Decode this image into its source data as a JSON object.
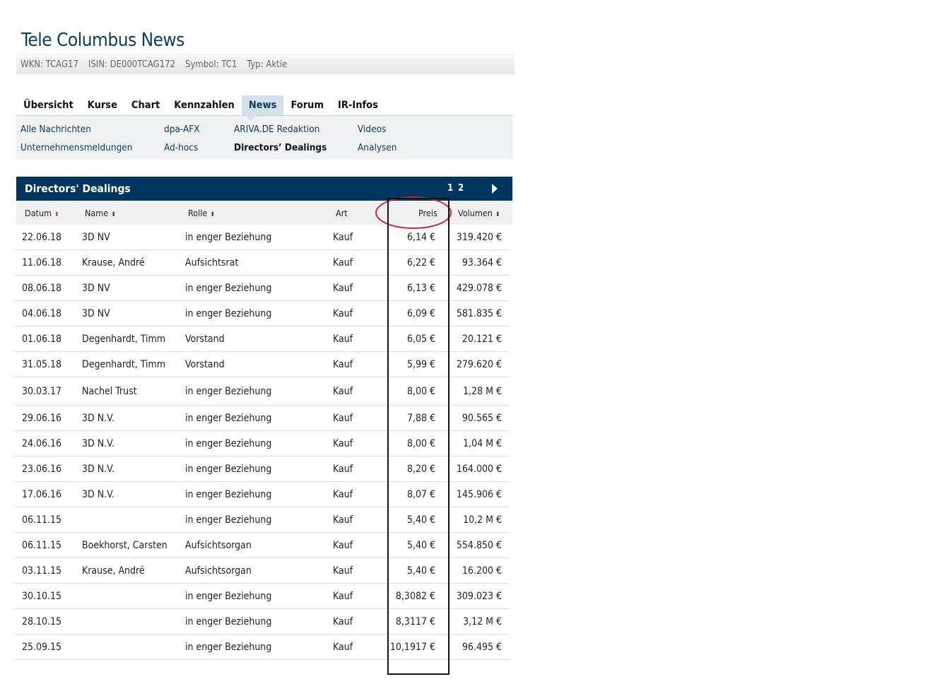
{
  "title": "Tele Columbus News",
  "meta": {
    "wkn": "WKN: TCAG17",
    "isin": "ISIN: DE000TCAG172",
    "symbol": "Symbol: TC1",
    "typ": "Typ: Aktie"
  },
  "tabs": [
    "Übersicht",
    "Kurse",
    "Chart",
    "Kennzahlen",
    "News",
    "Forum",
    "IR-Infos"
  ],
  "active_tab": "News",
  "subnav": {
    "alle": "Alle Nachrichten",
    "dpa": "dpa-AFX",
    "ariva": "ARIVA.DE Redaktion",
    "videos": "Videos",
    "unternehmen": "Unternehmensmeldungen",
    "adhocs": "Ad-hocs",
    "dd": "Directors’ Dealings",
    "analysen": "Analysen"
  },
  "section": {
    "title": "Directors' Dealings",
    "pages": [
      "1",
      "2"
    ]
  },
  "columns": {
    "datum": "Datum",
    "name": "Name",
    "rolle": "Rolle",
    "art": "Art",
    "preis": "Preis",
    "volumen": "Volumen"
  },
  "rows": [
    [
      "22.06.18",
      "3D NV",
      "in enger Beziehung",
      "Kauf",
      "6,14 €",
      "319.420 €"
    ],
    [
      "11.06.18",
      "Krause, André",
      "Aufsichtsrat",
      "Kauf",
      "6,22 €",
      "93.364 €"
    ],
    [
      "08.06.18",
      "3D NV",
      "in enger Beziehung",
      "Kauf",
      "6,13 €",
      "429.078 €"
    ],
    [
      "04.06.18",
      "3D NV",
      "in enger Beziehung",
      "Kauf",
      "6,09 €",
      "581.835 €"
    ],
    [
      "01.06.18",
      "Degenhardt, Timm",
      "Vorstand",
      "Kauf",
      "6,05 €",
      "20.121 €"
    ],
    [
      "31.05.18",
      "Degenhardt, Timm",
      "Vorstand",
      "Kauf",
      "5,99 €",
      "279.620 €"
    ],
    [
      "30.03.17",
      "Nachel Trust",
      "in enger Beziehung",
      "Kauf",
      "8,00 €",
      "1,28 M €"
    ],
    [
      "29.06.16",
      "3D N.V.",
      "in enger Beziehung",
      "Kauf",
      "7,88 €",
      "90.565 €"
    ],
    [
      "24.06.16",
      "3D N.V.",
      "in enger Beziehung",
      "Kauf",
      "8,00 €",
      "1,04 M €"
    ],
    [
      "23.06.16",
      "3D N.V.",
      "in enger Beziehung",
      "Kauf",
      "8,20 €",
      "164.000 €"
    ],
    [
      "17.06.16",
      "3D N.V.",
      "in enger Beziehung",
      "Kauf",
      "8,07 €",
      "145.906 €"
    ],
    [
      "06.11.15",
      "",
      "in enger Beziehung",
      "Kauf",
      "5,40 €",
      "10,2 M €"
    ],
    [
      "06.11.15",
      "Boekhorst, Carsten",
      "Aufsichtsorgan",
      "Kauf",
      "5,40 €",
      "554.850 €"
    ],
    [
      "03.11.15",
      "Krause, André",
      "Aufsichtsorgan",
      "Kauf",
      "5,40 €",
      "16.200 €"
    ],
    [
      "30.10.15",
      "",
      "in enger Beziehung",
      "Kauf",
      "8,3082 €",
      "309.023 €"
    ],
    [
      "28.10.15",
      "",
      "in enger Beziehung",
      "Kauf",
      "8,3117 €",
      "3,12 M €"
    ],
    [
      "25.09.15",
      "",
      "in enger Beziehung",
      "Kauf",
      "10,1917 €",
      "96.495 €"
    ]
  ]
}
